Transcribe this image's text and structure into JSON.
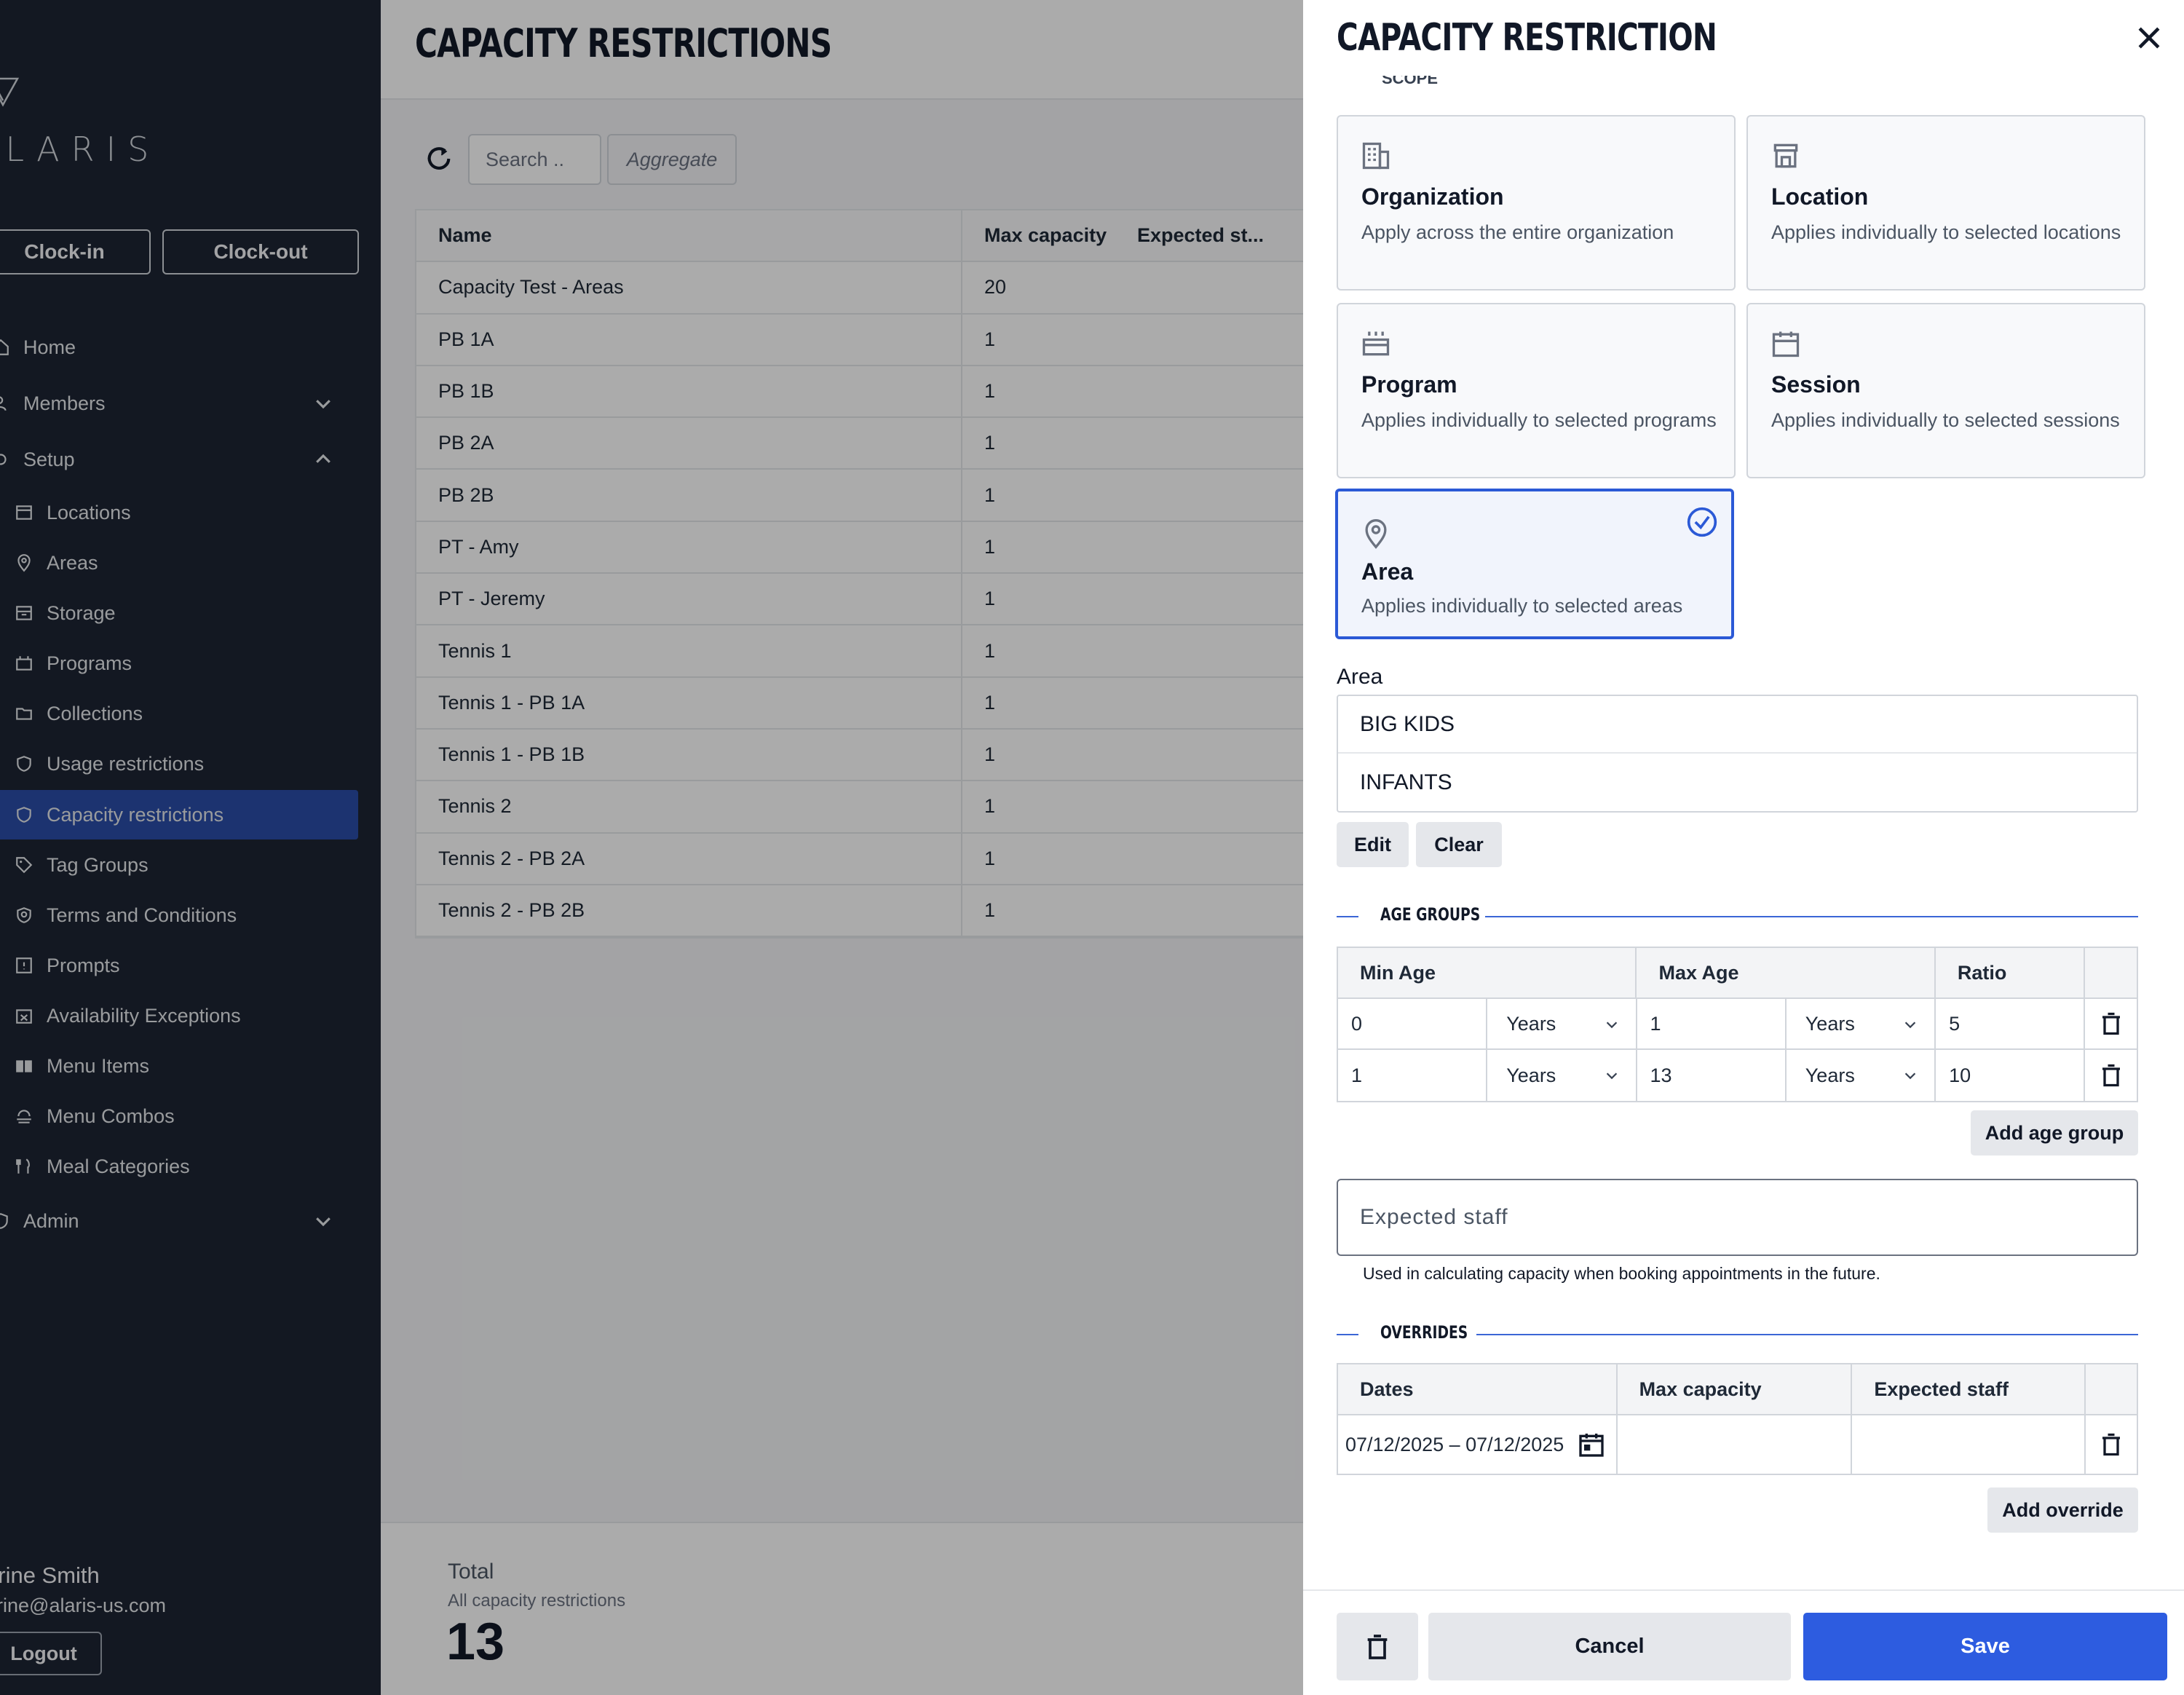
{
  "sidebar": {
    "logo_text": "ALARIS",
    "clock_in": "Clock-in",
    "clock_out": "Clock-out",
    "nav": {
      "home": "Home",
      "members": "Members",
      "setup": "Setup",
      "locations": "Locations",
      "areas": "Areas",
      "storage": "Storage",
      "programs": "Programs",
      "collections": "Collections",
      "usage_restrictions": "Usage restrictions",
      "capacity_restrictions": "Capacity restrictions",
      "tag_groups": "Tag Groups",
      "terms": "Terms and Conditions",
      "prompts": "Prompts",
      "availability": "Availability Exceptions",
      "menu_items": "Menu Items",
      "menu_combos": "Menu Combos",
      "meal_categories": "Meal Categories",
      "admin": "Admin"
    },
    "user_name": "erine Smith",
    "user_email": "erine@alaris-us.com",
    "logout": "Logout"
  },
  "main": {
    "title": "CAPACITY RESTRICTIONS",
    "search_placeholder": "Search ..",
    "aggregate": "Aggregate",
    "columns": [
      "Name",
      "Max capacity",
      "Expected st..."
    ],
    "rows": [
      {
        "name": "Capacity Test - Areas",
        "max": "20"
      },
      {
        "name": "PB 1A",
        "max": "1"
      },
      {
        "name": "PB 1B",
        "max": "1"
      },
      {
        "name": "PB 2A",
        "max": "1"
      },
      {
        "name": "PB 2B",
        "max": "1"
      },
      {
        "name": "PT - Amy",
        "max": "1"
      },
      {
        "name": "PT - Jeremy",
        "max": "1"
      },
      {
        "name": "Tennis 1",
        "max": "1"
      },
      {
        "name": "Tennis 1 - PB 1A",
        "max": "1"
      },
      {
        "name": "Tennis 1 - PB 1B",
        "max": "1"
      },
      {
        "name": "Tennis 2",
        "max": "1"
      },
      {
        "name": "Tennis 2 - PB 2A",
        "max": "1"
      },
      {
        "name": "Tennis 2 - PB 2B",
        "max": "1"
      }
    ],
    "total_label": "Total",
    "total_sub": "All capacity restrictions",
    "total_value": "13"
  },
  "drawer": {
    "title": "CAPACITY RESTRICTION",
    "scope_label": "SCOPE",
    "cards": {
      "organization": {
        "title": "Organization",
        "desc": "Apply across the entire organization"
      },
      "location": {
        "title": "Location",
        "desc": "Applies individually to selected locations"
      },
      "program": {
        "title": "Program",
        "desc": "Applies individually to selected programs"
      },
      "session": {
        "title": "Session",
        "desc": "Applies individually to selected sessions"
      },
      "area": {
        "title": "Area",
        "desc": "Applies individually to selected areas"
      }
    },
    "selected_scope": "Area",
    "area_label": "Area",
    "areas": [
      "BIG KIDS",
      "INFANTS"
    ],
    "edit": "Edit",
    "clear": "Clear",
    "age_groups_title": "AGE GROUPS",
    "age_headers": [
      "Min Age",
      "Max Age",
      "Ratio"
    ],
    "age_rows": [
      {
        "min": "0",
        "min_unit": "Years",
        "max": "1",
        "max_unit": "Years",
        "ratio": "5"
      },
      {
        "min": "1",
        "min_unit": "Years",
        "max": "13",
        "max_unit": "Years",
        "ratio": "10"
      }
    ],
    "add_age_group": "Add age group",
    "expected_staff_placeholder": "Expected staff",
    "expected_help": "Used in calculating capacity when booking appointments in the future.",
    "overrides_title": "OVERRIDES",
    "override_headers": [
      "Dates",
      "Max capacity",
      "Expected staff"
    ],
    "override_rows": [
      {
        "dates": "07/12/2025 – 07/12/2025",
        "max": "",
        "staff": ""
      }
    ],
    "add_override": "Add override",
    "cancel": "Cancel",
    "save": "Save"
  },
  "colors": {
    "sidebar_bg": "#1d2433",
    "active_nav": "#2b4da8",
    "primary": "#2d5ce0"
  }
}
